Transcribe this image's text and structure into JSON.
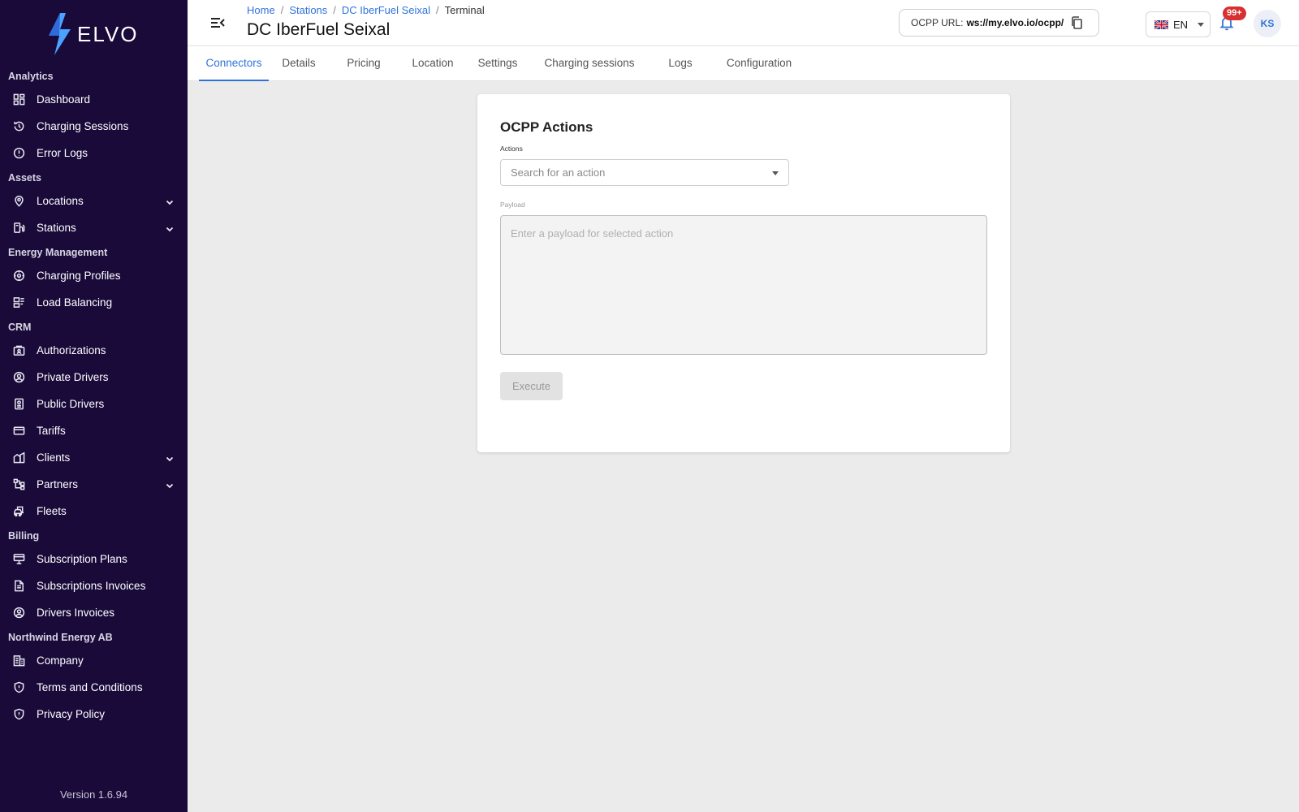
{
  "brand": {
    "name": "ELVO"
  },
  "sidebar": {
    "sections": [
      {
        "title": "Analytics",
        "items": [
          {
            "label": "Dashboard",
            "icon": "dashboard-icon",
            "expandable": false
          },
          {
            "label": "Charging Sessions",
            "icon": "history-icon",
            "expandable": false
          },
          {
            "label": "Error Logs",
            "icon": "alert-circle-icon",
            "expandable": false
          }
        ]
      },
      {
        "title": "Assets",
        "items": [
          {
            "label": "Locations",
            "icon": "map-pin-icon",
            "expandable": true
          },
          {
            "label": "Stations",
            "icon": "station-icon",
            "expandable": true
          }
        ]
      },
      {
        "title": "Energy Management",
        "items": [
          {
            "label": "Charging Profiles",
            "icon": "profile-gauge-icon",
            "expandable": false
          },
          {
            "label": "Load Balancing",
            "icon": "load-balancing-icon",
            "expandable": false
          }
        ]
      },
      {
        "title": "CRM",
        "items": [
          {
            "label": "Authorizations",
            "icon": "authorization-icon",
            "expandable": false
          },
          {
            "label": "Private Drivers",
            "icon": "user-circle-icon",
            "expandable": false
          },
          {
            "label": "Public Drivers",
            "icon": "badge-icon",
            "expandable": false
          },
          {
            "label": "Tariffs",
            "icon": "credit-card-icon",
            "expandable": false
          },
          {
            "label": "Clients",
            "icon": "building-icon",
            "expandable": true
          },
          {
            "label": "Partners",
            "icon": "hierarchy-icon",
            "expandable": true
          },
          {
            "label": "Fleets",
            "icon": "fleet-icon",
            "expandable": false
          }
        ]
      },
      {
        "title": "Billing",
        "items": [
          {
            "label": "Subscription Plans",
            "icon": "subscription-icon",
            "expandable": false
          },
          {
            "label": "Subscriptions Invoices",
            "icon": "document-icon",
            "expandable": false
          },
          {
            "label": "Drivers Invoices",
            "icon": "user-circle-icon",
            "expandable": false
          }
        ]
      },
      {
        "title": "Northwind Energy AB",
        "items": [
          {
            "label": "Company",
            "icon": "company-icon",
            "expandable": false
          },
          {
            "label": "Terms and Conditions",
            "icon": "shield-icon",
            "expandable": false
          },
          {
            "label": "Privacy Policy",
            "icon": "shield-icon",
            "expandable": false
          }
        ]
      }
    ],
    "version": "Version 1.6.94"
  },
  "header": {
    "breadcrumb": [
      "Home",
      "Stations",
      "DC IberFuel Seixal"
    ],
    "breadcrumb_current": "Terminal",
    "title": "DC IberFuel Seixal",
    "ocpp_label": "OCPP URL:",
    "ocpp_value": "ws://my.elvo.io/ocpp/",
    "language": "EN",
    "notification_count": "99+",
    "user_initials": "KS"
  },
  "tabs": [
    "Connectors",
    "Details",
    "Pricing",
    "Location",
    "Settings",
    "Charging sessions",
    "Logs",
    "Configuration"
  ],
  "active_tab": "Connectors",
  "card": {
    "title": "OCPP Actions",
    "actions_label": "Actions",
    "actions_placeholder": "Search for an action",
    "payload_label": "Payload",
    "payload_placeholder": "Enter a payload for selected action",
    "execute_label": "Execute"
  },
  "colors": {
    "sidebar_bg": "#190a3a",
    "accent": "#2f73d9",
    "badge": "#d63031",
    "logo_bolt": "#4aa3ff"
  }
}
